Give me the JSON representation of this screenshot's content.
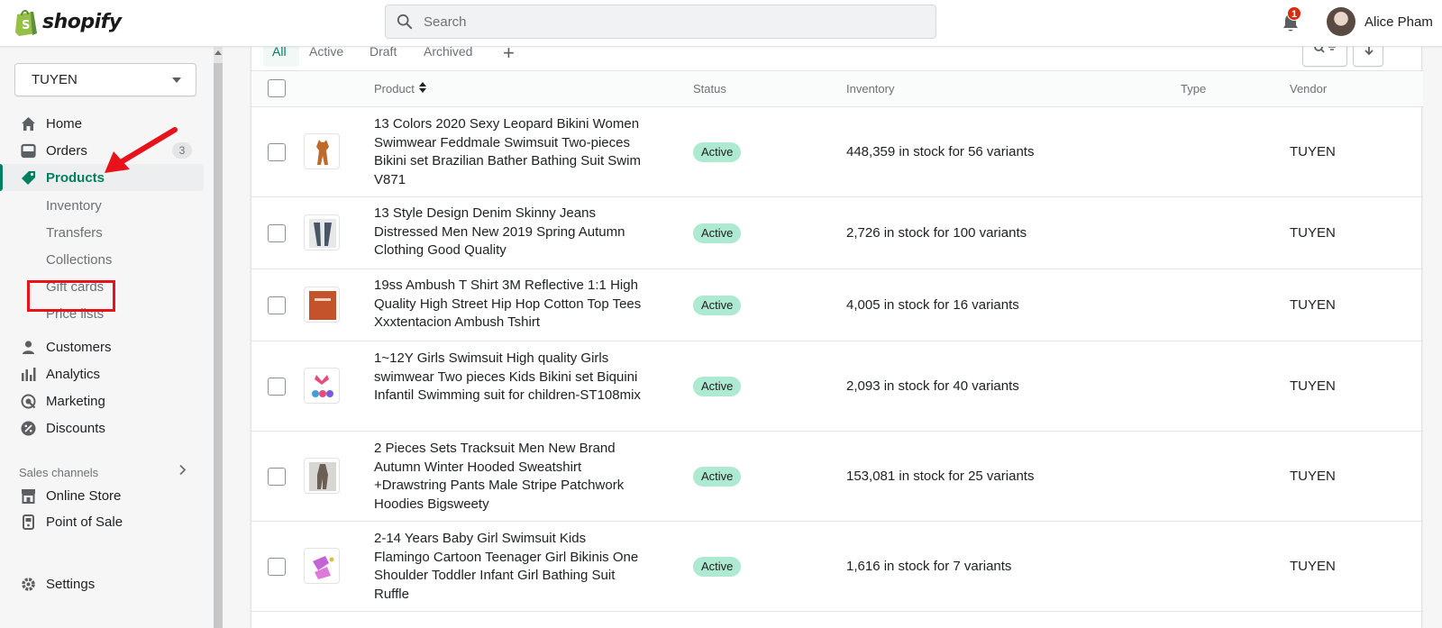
{
  "topbar": {
    "logo_text": "shopify",
    "search_placeholder": "Search",
    "notification_count": "1",
    "user_name": "Alice Pham"
  },
  "sidebar": {
    "store_name": "TUYEN",
    "nav": [
      {
        "label": "Home",
        "icon": "home-icon"
      },
      {
        "label": "Orders",
        "icon": "orders-icon",
        "count": "3"
      },
      {
        "label": "Products",
        "icon": "tag-icon",
        "active": true
      }
    ],
    "product_sub": [
      "Inventory",
      "Transfers",
      "Collections",
      "Gift cards",
      "Price lists"
    ],
    "nav2": [
      {
        "label": "Customers",
        "icon": "person-icon"
      },
      {
        "label": "Analytics",
        "icon": "bar-chart-icon"
      },
      {
        "label": "Marketing",
        "icon": "target-icon"
      },
      {
        "label": "Discounts",
        "icon": "discount-icon"
      }
    ],
    "sales_channels_label": "Sales channels",
    "channels": [
      {
        "label": "Online Store",
        "icon": "store-icon"
      },
      {
        "label": "Point of Sale",
        "icon": "pos-icon"
      }
    ],
    "settings_label": "Settings"
  },
  "tabs": [
    "All",
    "Active",
    "Draft",
    "Archived"
  ],
  "table": {
    "headers": {
      "product": "Product",
      "status": "Status",
      "inventory": "Inventory",
      "type": "Type",
      "vendor": "Vendor"
    },
    "rows": [
      {
        "title": "13 Colors 2020 Sexy Leopard Bikini Women Swimwear Feddmale Swimsuit Two-pieces Bikini set Brazilian Bather Bathing Suit Swim V871",
        "status": "Active",
        "inventory": "448,359 in stock for 56 variants",
        "type": "",
        "vendor": "TUYEN",
        "thumb_color": "#c06a2a"
      },
      {
        "title": "13 Style Design Denim Skinny Jeans Distressed Men New 2019 Spring Autumn Clothing Good Quality",
        "status": "Active",
        "inventory": "2,726 in stock for 100 variants",
        "type": "",
        "vendor": "TUYEN",
        "thumb_color": "#4a5566"
      },
      {
        "title": "19ss Ambush T Shirt 3M Reflective 1:1 High Quality High Street Hip Hop Cotton Top Tees Xxxtentacion Ambush Tshirt",
        "status": "Active",
        "inventory": "4,005 in stock for 16 variants",
        "type": "",
        "vendor": "TUYEN",
        "thumb_color": "#c4532b"
      },
      {
        "title": "1~12Y Girls Swimsuit High quality Girls swimwear Two pieces Kids Bikini set Biquini Infantil Swimming suit for children-ST108mix",
        "status": "Active",
        "inventory": "2,093 in stock for 40 variants",
        "type": "",
        "vendor": "TUYEN",
        "thumb_color": "#e84a7a"
      },
      {
        "title": "2 Pieces Sets Tracksuit Men New Brand Autumn Winter Hooded Sweatshirt +Drawstring Pants Male Stripe Patchwork Hoodies Bigsweety",
        "status": "Active",
        "inventory": "153,081 in stock for 25 variants",
        "type": "",
        "vendor": "TUYEN",
        "thumb_color": "#6b5e55"
      },
      {
        "title": "2-14 Years Baby Girl Swimsuit Kids Flamingo Cartoon Teenager Girl Bikinis One Shoulder Toddler Infant Girl Bathing Suit Ruffle",
        "status": "Active",
        "inventory": "1,616 in stock for 7 variants",
        "type": "",
        "vendor": "TUYEN",
        "thumb_color": "#c463d6"
      }
    ]
  },
  "colors": {
    "accent": "#008060",
    "active_badge": "#aee9d1",
    "annotation": "#e8121a"
  }
}
